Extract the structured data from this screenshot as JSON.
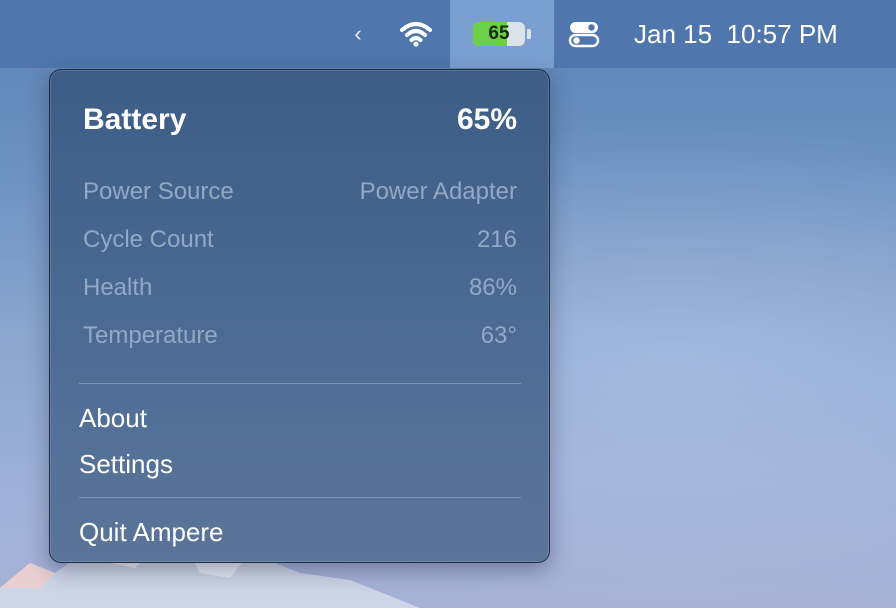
{
  "menubar": {
    "battery_level": "65",
    "battery_fraction": 0.65,
    "date": "Jan 15",
    "time": "10:57 PM",
    "icons": [
      "chevron-left-icon",
      "wifi-icon",
      "battery-icon",
      "control-center-icon"
    ]
  },
  "dropdown": {
    "title": "Battery",
    "percent": "65%",
    "stats": [
      {
        "label": "Power Source",
        "value": "Power Adapter"
      },
      {
        "label": "Cycle Count",
        "value": "216"
      },
      {
        "label": "Health",
        "value": "86%"
      },
      {
        "label": "Temperature",
        "value": "63°"
      }
    ],
    "menu": {
      "about": "About",
      "settings": "Settings",
      "quit": "Quit Ampere"
    }
  },
  "colors": {
    "menubar_bg": "#4f77ad",
    "battery_fill": "#6ad146",
    "menu_bg": "#466690",
    "secondary_text": "#93a8c4"
  }
}
